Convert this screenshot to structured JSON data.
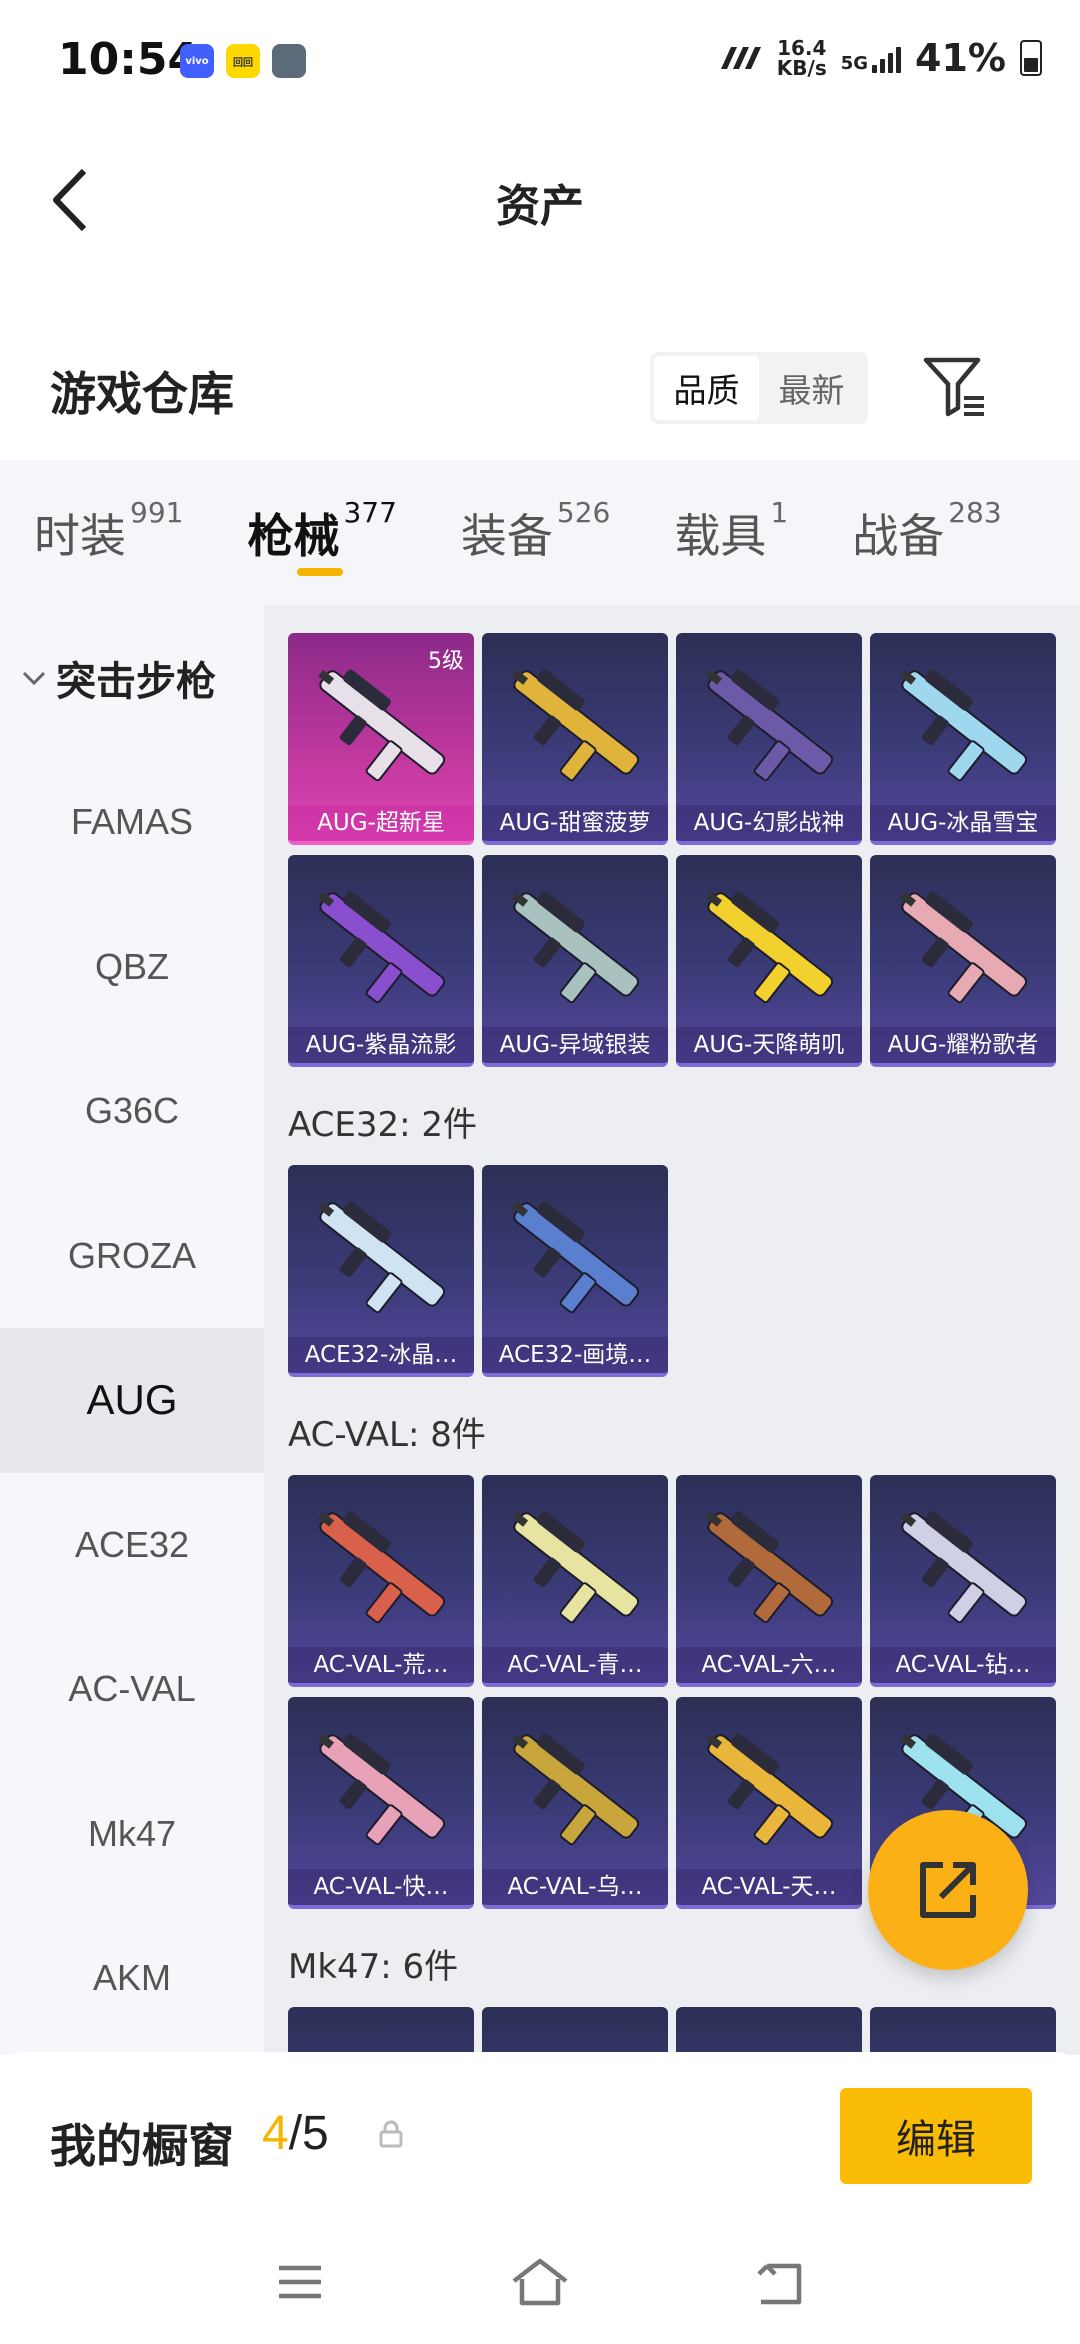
{
  "status_bar": {
    "time": "10:54",
    "apps": [
      "vivo",
      "回回",
      ""
    ],
    "net_speed_value": "16.4",
    "net_speed_unit": "KB/s",
    "network": "5G",
    "battery": "41%"
  },
  "header": {
    "title": "资产"
  },
  "warehouse": {
    "title": "游戏仓库",
    "sort_options": [
      "品质",
      "最新"
    ],
    "active_sort": "品质"
  },
  "tabs": [
    {
      "label": "时装",
      "count": "991"
    },
    {
      "label": "枪械",
      "count": "377"
    },
    {
      "label": "装备",
      "count": "526"
    },
    {
      "label": "载具",
      "count": "1"
    },
    {
      "label": "战备",
      "count": "283"
    }
  ],
  "sidebar": {
    "category": "突击步枪",
    "items": [
      "FAMAS",
      "QBZ",
      "G36C",
      "GROZA",
      "AUG",
      "ACE32",
      "AC-VAL",
      "Mk47",
      "AKM"
    ],
    "active": "AUG"
  },
  "sections": {
    "aug_items": [
      {
        "name": "AUG-超新星",
        "level": "5级",
        "color": "#e8e0e8"
      },
      {
        "name": "AUG-甜蜜菠萝",
        "color": "#e0b43a"
      },
      {
        "name": "AUG-幻影战神",
        "color": "#6c5aa8"
      },
      {
        "name": "AUG-冰晶雪宝",
        "color": "#9fd7ef"
      },
      {
        "name": "AUG-紫晶流影",
        "color": "#8a4fcf"
      },
      {
        "name": "AUG-异域银装",
        "color": "#a9c2c0"
      },
      {
        "name": "AUG-天降萌叽",
        "color": "#f2d02e"
      },
      {
        "name": "AUG-耀粉歌者",
        "color": "#e7a9b2"
      }
    ],
    "ace32_title": "ACE32: 2件",
    "ace32_items": [
      {
        "name": "ACE32-冰晶…",
        "color": "#cfe3f3"
      },
      {
        "name": "ACE32-画境…",
        "color": "#5a7fcf"
      }
    ],
    "acval_title": "AC-VAL: 8件",
    "acval_items": [
      {
        "name": "AC-VAL-荒…",
        "color": "#d9604a"
      },
      {
        "name": "AC-VAL-青…",
        "color": "#e7e3a0"
      },
      {
        "name": "AC-VAL-六…",
        "color": "#b06a3c"
      },
      {
        "name": "AC-VAL-钻…",
        "color": "#cfcfe6"
      },
      {
        "name": "AC-VAL-快…",
        "color": "#e8a2b8"
      },
      {
        "name": "AC-VAL-乌…",
        "color": "#c8a63c"
      },
      {
        "name": "AC-VAL-天…",
        "color": "#e9b53a"
      },
      {
        "name": "",
        "color": "#9fe2ef"
      }
    ],
    "mk47_title": "Mk47: 6件"
  },
  "showcase": {
    "label": "我的橱窗",
    "current": "4",
    "total": "/5",
    "edit_label": "编辑"
  },
  "colors": {
    "accent": "#f5b400",
    "card_bg": "#3b3b78",
    "highlight_card": "#c1389f"
  }
}
